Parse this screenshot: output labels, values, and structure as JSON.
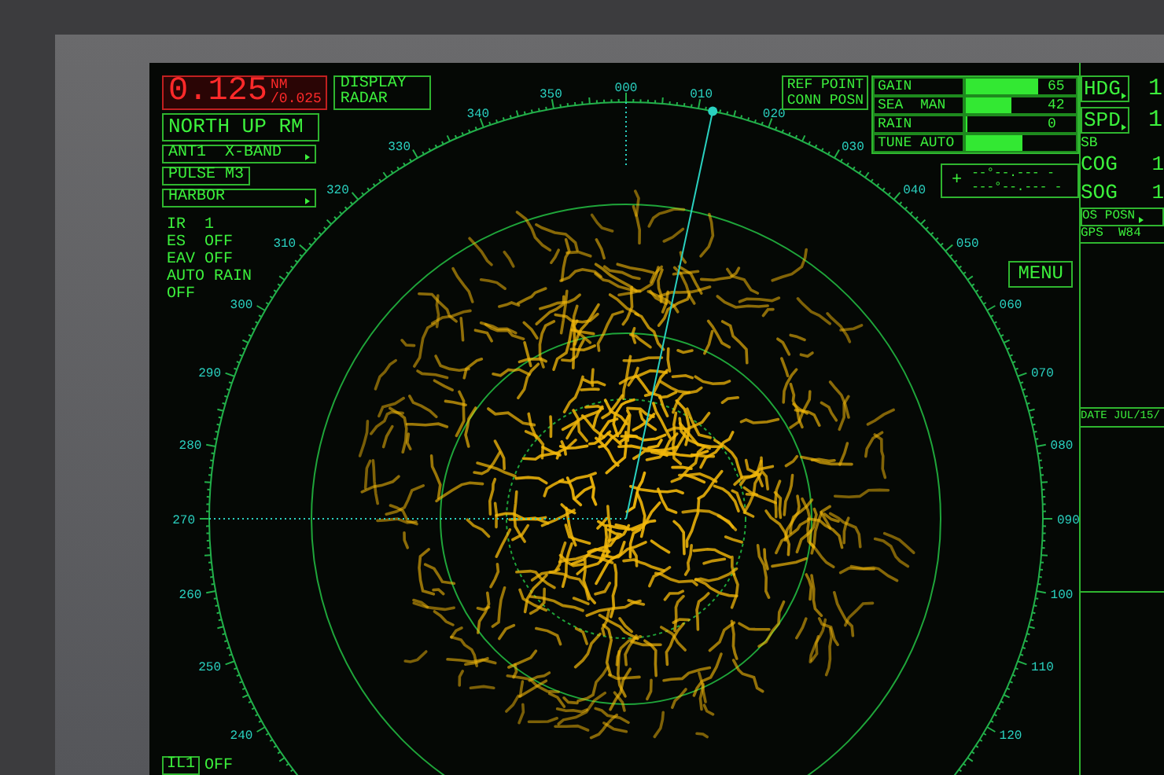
{
  "range": {
    "value": "0.125",
    "unit": "NM",
    "ring_interval": "/0.025"
  },
  "display_mode": [
    "DISPLAY",
    "RADAR"
  ],
  "orientation": "NORTH UP RM",
  "settings": [
    {
      "label": "ANT1  X-BAND",
      "submenu": true
    },
    {
      "label": "PULSE M3",
      "submenu": false
    },
    {
      "label": "HARBOR",
      "submenu": true
    }
  ],
  "status": [
    "IR  1",
    "ES  OFF",
    "EAV OFF",
    "AUTO RAIN",
    "OFF"
  ],
  "interference": {
    "label": "IL1",
    "value": "OFF"
  },
  "ref_point": [
    "REF POINT",
    "CONN POSN"
  ],
  "adjustments": [
    {
      "label": "GAIN",
      "value": "65",
      "level": 0.65
    },
    {
      "label": "SEA  MAN",
      "value": "42",
      "level": 0.42
    },
    {
      "label": "RAIN",
      "value": "0",
      "level": 0
    },
    {
      "label": "TUNE AUTO",
      "level": 0.51
    }
  ],
  "cursor_readout": {
    "symbol": "+",
    "lines": [
      "--°--.--- -",
      "---°--.--- -"
    ]
  },
  "menu_button": "MENU",
  "bearing_labels_east": [
    "000",
    "010",
    "020",
    "030",
    "040",
    "050",
    "060",
    "070",
    "080",
    "090",
    "100",
    "110",
    "120"
  ],
  "bearing_labels_west": [
    "350",
    "340",
    "330",
    "320",
    "310",
    "300",
    "290",
    "280",
    "270",
    "260",
    "250",
    "240"
  ],
  "navigation": [
    {
      "label": "HDG",
      "value": "1",
      "submenu": true
    },
    {
      "label": "SPD",
      "value": "1",
      "submenu": true
    }
  ],
  "speed_reference": "SB",
  "course": [
    {
      "label": "COG",
      "value": "1"
    },
    {
      "label": "SOG",
      "value": "1"
    }
  ],
  "position": {
    "label": "OS POSN",
    "submenu": true
  },
  "datum": "GPS  W84",
  "date": "DATE JUL/15/"
}
